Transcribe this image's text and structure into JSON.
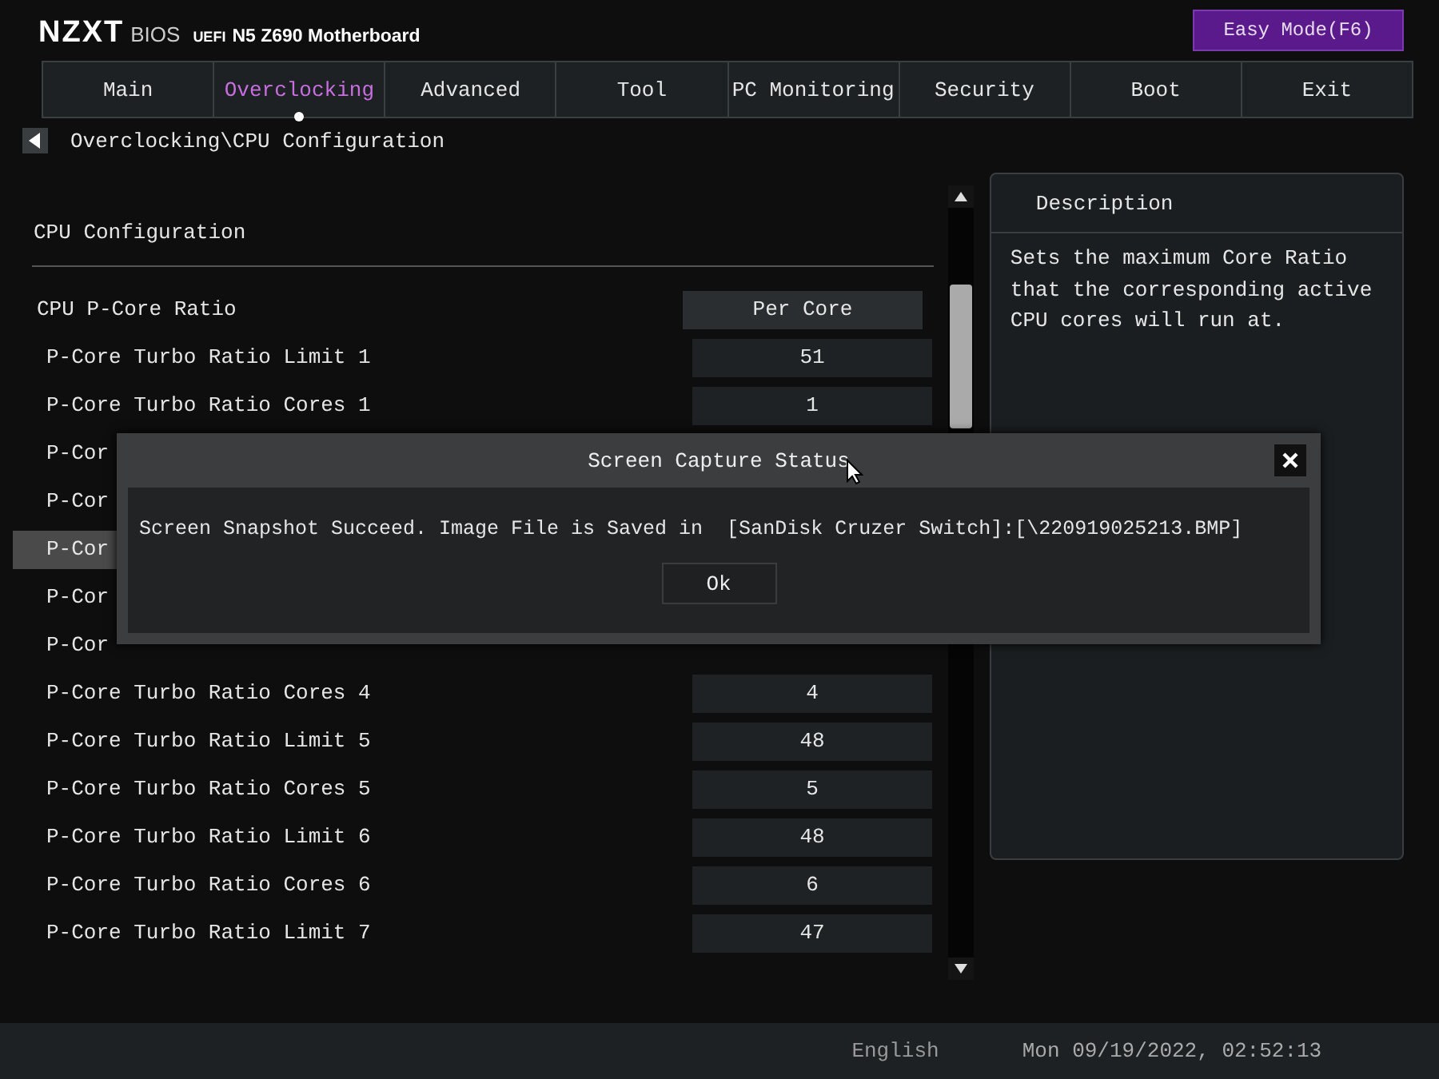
{
  "header": {
    "brand": "NZXT",
    "product": "BIOS",
    "firmware": "UEFI",
    "board": "N5 Z690 Motherboard",
    "mode_button": "Easy Mode(F6)"
  },
  "tabs": [
    {
      "label": "Main",
      "selected": false
    },
    {
      "label": "Overclocking",
      "selected": true
    },
    {
      "label": "Advanced",
      "selected": false
    },
    {
      "label": "Tool",
      "selected": false
    },
    {
      "label": "PC Monitoring",
      "selected": false
    },
    {
      "label": "Security",
      "selected": false
    },
    {
      "label": "Boot",
      "selected": false
    },
    {
      "label": "Exit",
      "selected": false
    }
  ],
  "breadcrumb": "Overclocking\\CPU Configuration",
  "section_title": "CPU Configuration",
  "settings": [
    {
      "label": "CPU P-Core Ratio",
      "value": "Per Core",
      "selected": false,
      "kind": "header"
    },
    {
      "label": "P-Core Turbo Ratio Limit 1",
      "value": "51",
      "selected": false,
      "kind": "item"
    },
    {
      "label": "P-Core Turbo Ratio Cores 1",
      "value": "1",
      "selected": false,
      "kind": "item"
    },
    {
      "label": "P-Cor",
      "selected": false,
      "kind": "item"
    },
    {
      "label": "P-Cor",
      "selected": false,
      "kind": "item"
    },
    {
      "label": "P-Cor",
      "selected": true,
      "kind": "item"
    },
    {
      "label": "P-Cor",
      "selected": false,
      "kind": "item"
    },
    {
      "label": "P-Cor",
      "selected": false,
      "kind": "item"
    },
    {
      "label": "P-Core Turbo Ratio Cores 4",
      "value": "4",
      "selected": false,
      "kind": "item"
    },
    {
      "label": "P-Core Turbo Ratio Limit 5",
      "value": "48",
      "selected": false,
      "kind": "item"
    },
    {
      "label": "P-Core Turbo Ratio Cores 5",
      "value": "5",
      "selected": false,
      "kind": "item"
    },
    {
      "label": "P-Core Turbo Ratio Limit 6",
      "value": "48",
      "selected": false,
      "kind": "item"
    },
    {
      "label": "P-Core Turbo Ratio Cores 6",
      "value": "6",
      "selected": false,
      "kind": "item"
    },
    {
      "label": "P-Core Turbo Ratio Limit 7",
      "value": "47",
      "selected": false,
      "kind": "item"
    }
  ],
  "description": {
    "title": "Description",
    "text": "Sets the maximum Core Ratio that the corresponding active CPU cores will run at."
  },
  "dialog": {
    "title": "Screen Capture Status",
    "message": "Screen Snapshot Succeed. Image File is Saved in  [SanDisk Cruzer Switch]:[\\220919025213.BMP]",
    "button": "Ok"
  },
  "status_bar": {
    "language": "English",
    "datetime": "Mon 09/19/2022, 02:52:13"
  }
}
